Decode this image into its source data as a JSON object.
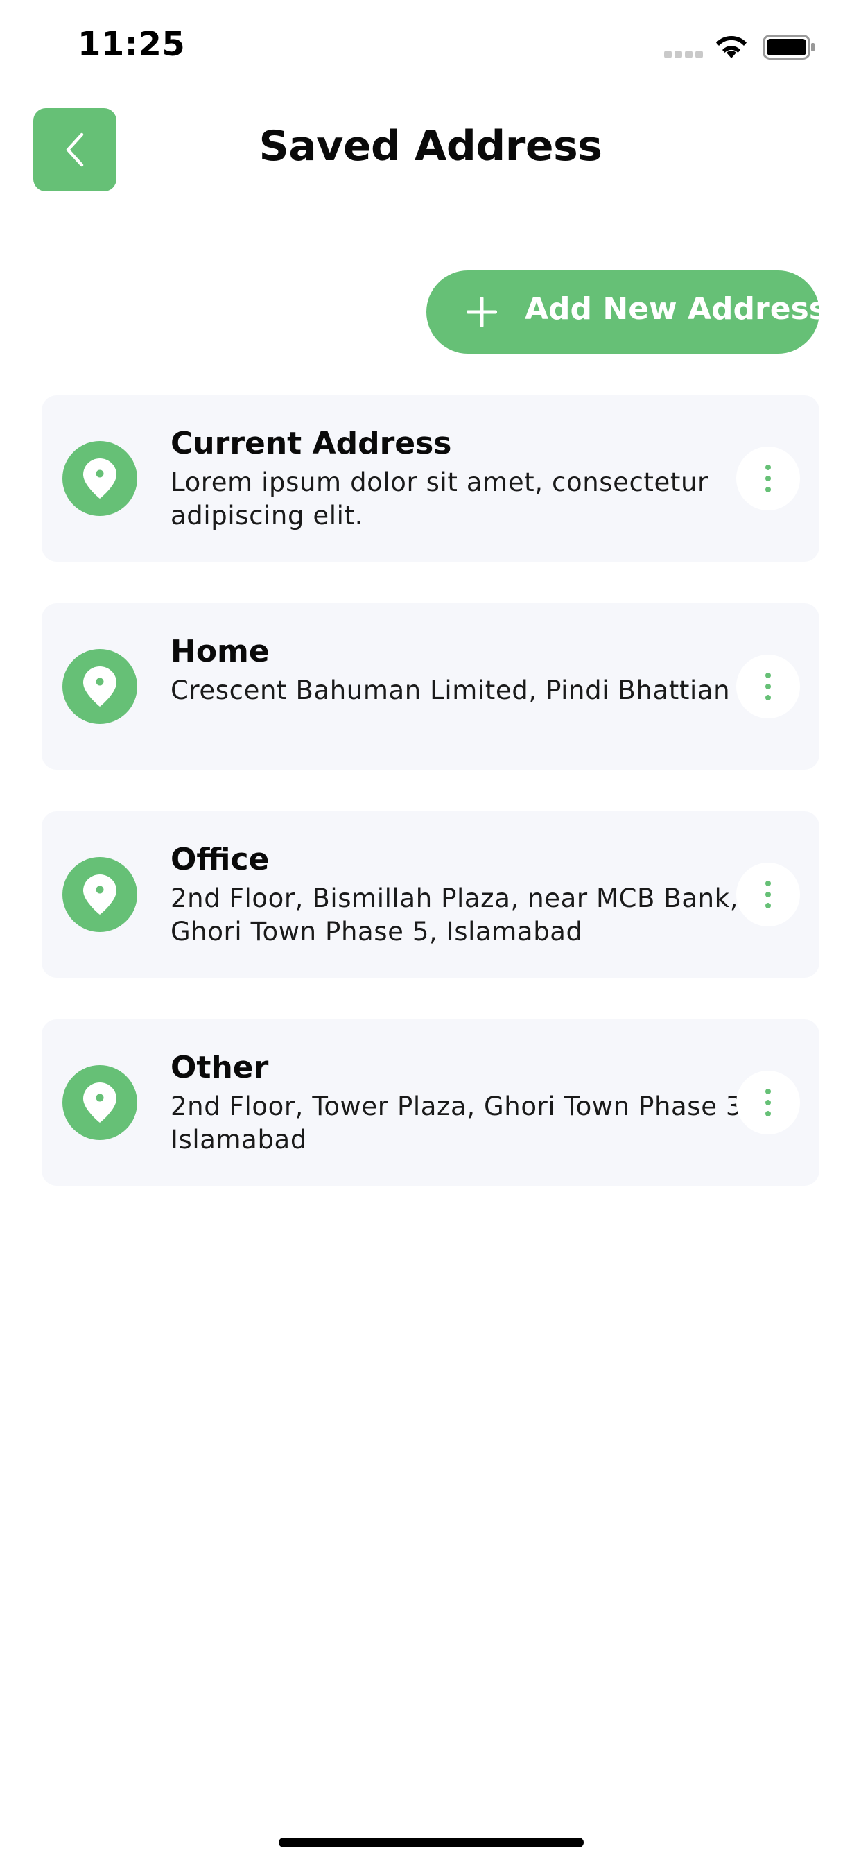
{
  "status_bar": {
    "time": "11:25"
  },
  "header": {
    "title": "Saved Address",
    "back_icon": "chevron-left-icon"
  },
  "add_button": {
    "label": "Add New Address",
    "icon": "plus-icon"
  },
  "addresses": [
    {
      "title": "Current Address",
      "address": "Lorem ipsum dolor sit amet, consectetur adipiscing elit."
    },
    {
      "title": "Home",
      "address": "Crescent Bahuman Limited, Pindi Bhattian"
    },
    {
      "title": "Office",
      "address": "2nd Floor, Bismillah Plaza, near MCB Bank, Ghori Town Phase 5, Islamabad"
    },
    {
      "title": "Other",
      "address": "2nd Floor, Tower Plaza, Ghori Town Phase 3, Islamabad"
    }
  ],
  "colors": {
    "accent": "#66c076",
    "card_background": "#f6f7fb",
    "title_text": "#0a0a0a"
  }
}
